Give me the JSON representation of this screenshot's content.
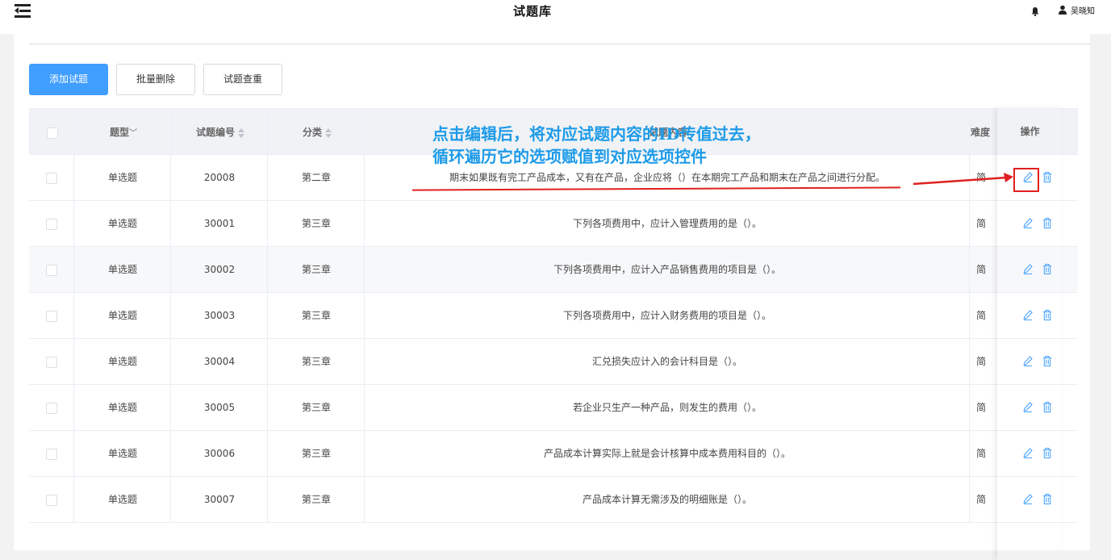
{
  "app": {
    "title": "试题库",
    "user_name": "吴晓知"
  },
  "toolbar": {
    "add_label": "添加试题",
    "batch_delete_label": "批量删除",
    "check_duplicate_label": "试题查重"
  },
  "table": {
    "headers": {
      "type": "题型",
      "number": "试题编号",
      "category": "分类",
      "content": "试题内容",
      "difficulty": "难度",
      "actions": "操作"
    },
    "rows": [
      {
        "type": "单选题",
        "number": "20008",
        "category": "第二章",
        "content": "期末如果既有完工产品成本，又有在产品，企业应将（）在本期完工产品和期末在产品之间进行分配。",
        "difficulty": "简"
      },
      {
        "type": "单选题",
        "number": "30001",
        "category": "第三章",
        "content": "下列各项费用中，应计入管理费用的是（）。",
        "difficulty": "简"
      },
      {
        "type": "单选题",
        "number": "30002",
        "category": "第三章",
        "content": "下列各项费用中，应计入产品销售费用的项目是（）。",
        "difficulty": "简"
      },
      {
        "type": "单选题",
        "number": "30003",
        "category": "第三章",
        "content": "下列各项费用中，应计入财务费用的项目是（）。",
        "difficulty": "简"
      },
      {
        "type": "单选题",
        "number": "30004",
        "category": "第三章",
        "content": "汇兑损失应计入的会计科目是（）。",
        "difficulty": "简"
      },
      {
        "type": "单选题",
        "number": "30005",
        "category": "第三章",
        "content": "若企业只生产一种产品，则发生的费用（）。",
        "difficulty": "简"
      },
      {
        "type": "单选题",
        "number": "30006",
        "category": "第三章",
        "content": "产品成本计算实际上就是会计核算中成本费用科目的（）。",
        "difficulty": "简"
      },
      {
        "type": "单选题",
        "number": "30007",
        "category": "第三章",
        "content": "产品成本计算无需涉及的明细账是（）。",
        "difficulty": "简"
      }
    ]
  },
  "annotation": {
    "line1": "点击编辑后，将对应试题内容的ID传值过去，",
    "line2": "循环遍历它的选项赋值到对应选项控件"
  },
  "colors": {
    "primary": "#409eff",
    "annotation": "#1e9be8",
    "highlight": "#e02020"
  }
}
